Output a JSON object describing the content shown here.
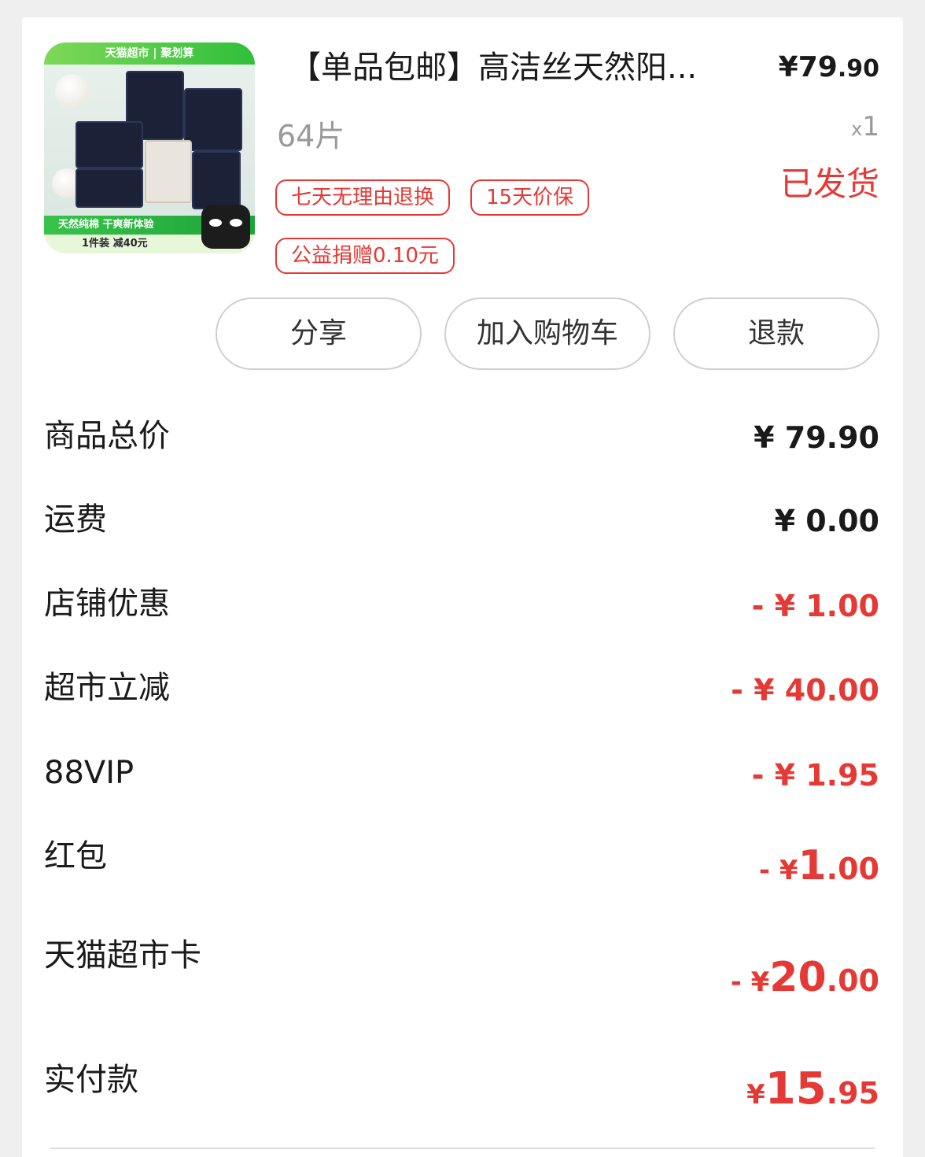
{
  "product": {
    "thumbnail_top_text": "天猫超市 | 聚划算",
    "thumbnail_mid_text": "天然纯棉 干爽新体验",
    "thumbnail_bottom_text": "1件装 减40元",
    "title": "【单品包邮】高洁丝天然阳...",
    "price_symbol": "¥",
    "price_int": "79",
    "price_dec": ".90",
    "spec": "64片",
    "qty_prefix": "x",
    "qty": "1",
    "status": "已发货",
    "tags": [
      "七天无理由退换",
      "15天价保",
      "公益捐赠0.10元"
    ]
  },
  "actions": {
    "share": "分享",
    "add_to_cart": "加入购物车",
    "refund": "退款"
  },
  "fees": [
    {
      "label": "商品总价",
      "value": "¥ 79.90",
      "color": "#1a1a1a"
    },
    {
      "label": "运费",
      "value": "¥ 0.00",
      "color": "#1a1a1a"
    },
    {
      "label": "店铺优惠",
      "value": "- ¥ 1.00",
      "color": "#e53935"
    },
    {
      "label": "超市立减",
      "value": "- ¥ 40.00",
      "color": "#e53935"
    },
    {
      "label": "88VIP",
      "value": "- ¥ 1.95",
      "color": "#e53935"
    },
    {
      "label": "红包",
      "value_prefix": "- ¥",
      "value_int": "1",
      "value_dec": ".00",
      "color": "#e53935"
    },
    {
      "label": "天猫超市卡",
      "value_prefix": "- ¥",
      "value_int": "20",
      "value_dec": ".00",
      "color": "#e53935"
    }
  ],
  "total": {
    "label": "实付款",
    "symbol": "¥",
    "int": "15",
    "dec": ".95",
    "color": "#e53935"
  }
}
